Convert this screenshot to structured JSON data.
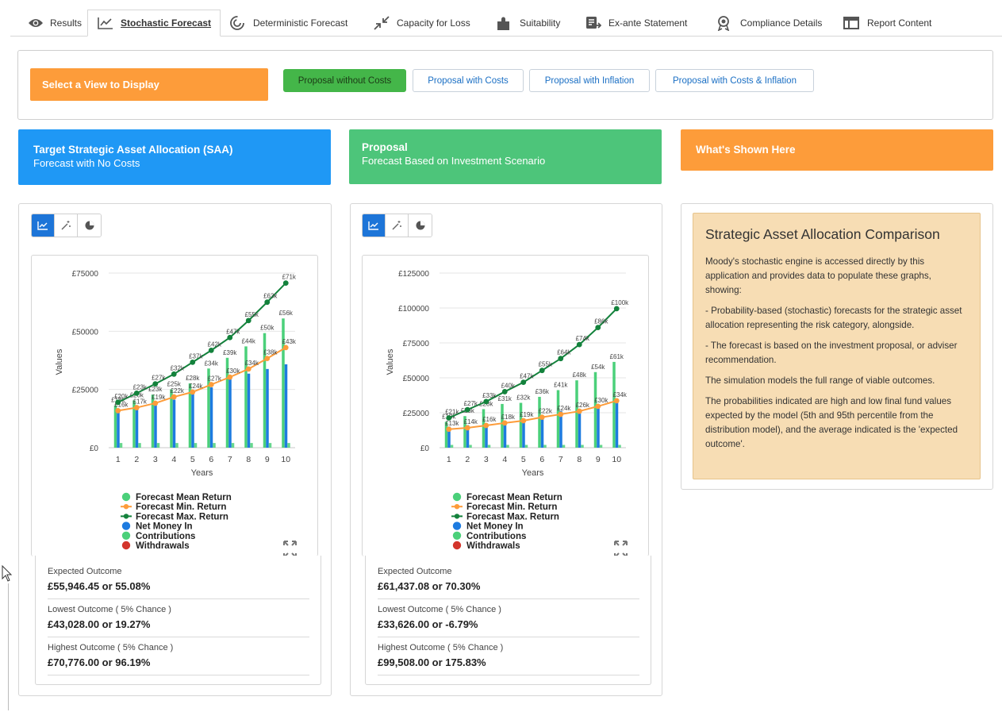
{
  "tabs": [
    {
      "label": "Results",
      "icon": "eye-icon"
    },
    {
      "label": "Stochastic Forecast",
      "icon": "line-chart-icon"
    },
    {
      "label": "Deterministic Forecast",
      "icon": "spiral-icon"
    },
    {
      "label": "Capacity for Loss",
      "icon": "compress-icon"
    },
    {
      "label": "Suitability",
      "icon": "puzzle-icon"
    },
    {
      "label": "Ex-ante Statement",
      "icon": "document-list-icon"
    },
    {
      "label": "Compliance Details",
      "icon": "award-icon"
    },
    {
      "label": "Report Content",
      "icon": "table-icon"
    }
  ],
  "view_selector": {
    "title": "Select a View to Display",
    "options": [
      "Proposal without Costs",
      "Proposal with Costs",
      "Proposal with Inflation",
      "Proposal with Costs & Inflation"
    ],
    "selected": "Proposal without Costs"
  },
  "colors": {
    "blue_header": "#1f98f5",
    "green_header": "#4dc57a",
    "orange_header": "#fd9c3a",
    "mean": "#4bd07a",
    "min": "#fd9c3a",
    "max": "#13823c",
    "net_money": "#1d7be0",
    "withdrawals": "#d3352c"
  },
  "saa": {
    "title": "Target Strategic Asset Allocation (SAA)",
    "subtitle": "Forecast with No Costs",
    "outcomes": [
      {
        "label": "Expected Outcome",
        "value": "£55,946.45 or 55.08%"
      },
      {
        "label": "Lowest Outcome ( 5% Chance )",
        "value": "£43,028.00 or 19.27%"
      },
      {
        "label": "Highest Outcome ( 5% Chance )",
        "value": "£70,776.00 or 96.19%"
      }
    ]
  },
  "proposal": {
    "title": "Proposal",
    "subtitle": "Forecast Based on Investment Scenario",
    "outcomes": [
      {
        "label": "Expected Outcome",
        "value": "£61,437.08 or 70.30%"
      },
      {
        "label": "Lowest Outcome ( 5% Chance )",
        "value": "£33,626.00 or -6.79%"
      },
      {
        "label": "Highest Outcome ( 5% Chance )",
        "value": "£99,508.00 or 175.83%"
      }
    ]
  },
  "shown_here": {
    "title": "What's Shown Here",
    "box_title": "Strategic Asset Allocation Comparison",
    "paragraphs": [
      "Moody's stochastic engine is accessed directly by this application and provides data to populate these graphs, showing:",
      "- Probability-based (stochastic) forecasts for the strategic asset allocation representing the risk category, alongside.",
      "- The forecast is based on the investment proposal, or adviser recommendation.",
      "The simulation models the full range of viable outcomes.",
      "The probabilities indicated are high and low final fund values expected by the model (5th and 95th percentile from the distribution model), and the average indicated is the 'expected outcome'."
    ]
  },
  "chart_data": [
    {
      "type": "bar",
      "xlabel": "Years",
      "ylabel": "Values",
      "categories": [
        "1",
        "2",
        "3",
        "4",
        "5",
        "6",
        "7",
        "8",
        "9",
        "10"
      ],
      "yticks": [
        "£0",
        "£25000",
        "£50000",
        "£75000"
      ],
      "ylim": [
        0,
        75000
      ],
      "series": [
        {
          "name": "Forecast Mean Return",
          "kind": "bar",
          "values": [
            18200,
            20300,
            22800,
            25000,
            27600,
            34000,
            38600,
            43500,
            49200,
            55500
          ],
          "labels": [
            "£18k",
            "£20k",
            "£23k",
            "£25k",
            "£28k",
            "£34k",
            "£39k",
            "£44k",
            "£50k",
            "£56k"
          ]
        },
        {
          "name": "Forecast Min. Return",
          "kind": "line",
          "values": [
            15900,
            17200,
            19100,
            21800,
            23900,
            27100,
            30300,
            33800,
            38300,
            43000
          ],
          "labels": [
            "£16k",
            "£17k",
            "£19k",
            "£22k",
            "£24k",
            "£27k",
            "£30k",
            "£34k",
            "£38k",
            "£43k"
          ]
        },
        {
          "name": "Forecast Max. Return",
          "kind": "line",
          "values": [
            19500,
            23400,
            27400,
            31600,
            36700,
            41800,
            47300,
            54600,
            62500,
            70700
          ],
          "labels": [
            "£20k",
            "£23k",
            "£27k",
            "£32k",
            "£37k",
            "£42k",
            "£47k",
            "£55k",
            "£63k",
            "£71k"
          ]
        },
        {
          "name": "Net Money In",
          "kind": "bar",
          "values": [
            16100,
            17100,
            18800,
            20600,
            23400,
            25900,
            29600,
            31800,
            33800,
            35800
          ]
        },
        {
          "name": "Contributions",
          "kind": "bar",
          "values": [
            2000,
            2000,
            2000,
            2000,
            2000,
            2000,
            2000,
            2000,
            2000,
            2000
          ]
        },
        {
          "name": "Withdrawals",
          "kind": "bar",
          "values": [
            0,
            0,
            0,
            0,
            0,
            0,
            0,
            0,
            0,
            0
          ]
        }
      ]
    },
    {
      "type": "bar",
      "xlabel": "Years",
      "ylabel": "Values",
      "categories": [
        "1",
        "2",
        "3",
        "4",
        "5",
        "6",
        "7",
        "8",
        "9",
        "10"
      ],
      "yticks": [
        "£0",
        "£25000",
        "£50000",
        "£75000",
        "£100000",
        "£125000"
      ],
      "ylim": [
        0,
        125000
      ],
      "series": [
        {
          "name": "Forecast Mean Return",
          "kind": "bar",
          "values": [
            18500,
            22600,
            27600,
            31300,
            32100,
            36400,
            41200,
            48200,
            54100,
            61400
          ],
          "labels": [
            "£18k",
            "£23k",
            "£28k",
            "£31k",
            "£32k",
            "£36k",
            "£41k",
            "£48k",
            "£54k",
            "£61k"
          ]
        },
        {
          "name": "Forecast Min. Return",
          "kind": "line",
          "values": [
            13200,
            14200,
            15900,
            17700,
            19300,
            21800,
            23900,
            26100,
            29600,
            33600
          ],
          "labels": [
            "£13k",
            "£14k",
            "£16k",
            "£18k",
            "£19k",
            "£22k",
            "£24k",
            "£26k",
            "£30k",
            "£34k"
          ]
        },
        {
          "name": "Forecast Max. Return",
          "kind": "line",
          "values": [
            21300,
            27200,
            33000,
            40100,
            46800,
            55300,
            63800,
            73800,
            86000,
            99500
          ],
          "labels": [
            "£21k",
            "£27k",
            "£33k",
            "£40k",
            "£47k",
            "£55k",
            "£64k",
            "£74k",
            "£86k",
            "£100k"
          ]
        },
        {
          "name": "Net Money In",
          "kind": "bar",
          "values": [
            15100,
            16100,
            17300,
            18100,
            19300,
            21300,
            26300,
            27600,
            30300,
            34600
          ]
        },
        {
          "name": "Contributions",
          "kind": "bar",
          "values": [
            2000,
            2000,
            2000,
            2000,
            2000,
            2000,
            2000,
            2000,
            2000,
            2000
          ]
        },
        {
          "name": "Withdrawals",
          "kind": "bar",
          "values": [
            0,
            0,
            0,
            0,
            0,
            0,
            0,
            0,
            0,
            0
          ]
        }
      ]
    }
  ]
}
